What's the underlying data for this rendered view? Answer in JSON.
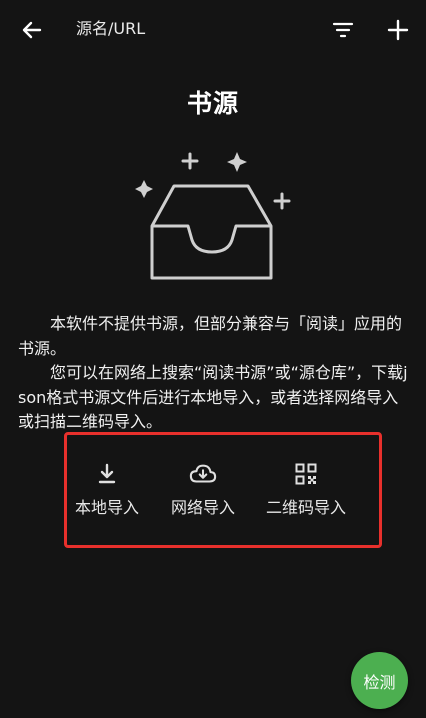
{
  "topbar": {
    "search_placeholder": "源名/URL",
    "back_icon": "arrow-left-icon",
    "filter_icon": "filter-icon",
    "add_icon": "plus-icon"
  },
  "title": "书源",
  "illustration_icon": "empty-inbox-icon",
  "description": {
    "line1": "本软件不提供书源，但部分兼容与「阅读」应用的书源。",
    "line2": "您可以在网络上搜索“阅读书源”或“源仓库”，下载json格式书源文件后进行本地导入，或者选择网络导入或扫描二维码导入。"
  },
  "import_options": [
    {
      "label": "本地导入",
      "icon": "download-icon"
    },
    {
      "label": "网络导入",
      "icon": "cloud-download-icon"
    },
    {
      "label": "二维码导入",
      "icon": "qr-code-icon"
    }
  ],
  "fab": {
    "label": "检测"
  },
  "colors": {
    "background": "#141414",
    "highlight_border": "#e8302c",
    "fab": "#4caf50",
    "text": "#f2f2f2"
  }
}
